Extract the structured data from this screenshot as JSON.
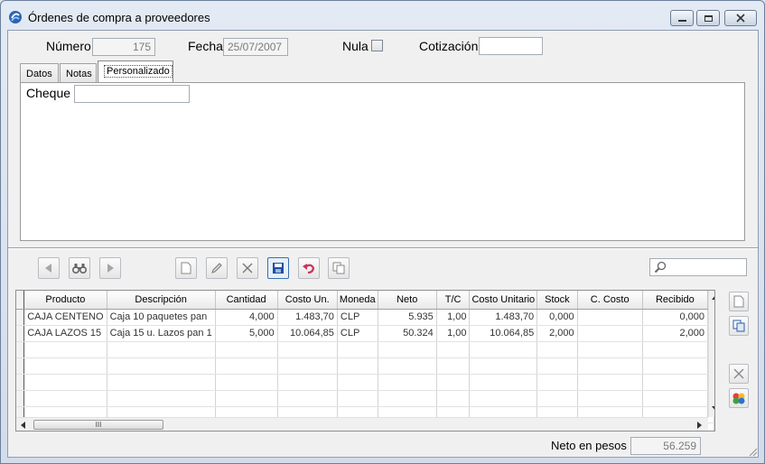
{
  "window": {
    "title": "Órdenes de compra a proveedores"
  },
  "header": {
    "numero_label": "Número",
    "numero_value": "175",
    "fecha_label": "Fecha",
    "fecha_value": "25/07/2007",
    "nula_label": "Nula",
    "nula_checked": false,
    "cotizacion_label": "Cotización",
    "cotizacion_value": ""
  },
  "tabs": [
    {
      "label": "Datos",
      "active": false
    },
    {
      "label": "Notas",
      "active": false
    },
    {
      "label": "Personalizado",
      "active": true
    }
  ],
  "panel": {
    "cheque_label": "Cheque",
    "cheque_value": ""
  },
  "toolbar": {
    "icons": [
      "arrow-left-icon",
      "binoculars-icon",
      "arrow-right-icon",
      "new-document-icon",
      "pencil-icon",
      "delete-x-icon",
      "save-disk-icon",
      "undo-icon",
      "copy-icon"
    ],
    "search_value": ""
  },
  "grid": {
    "columns": [
      "Producto",
      "Descripción",
      "Cantidad",
      "Costo Un.",
      "Moneda",
      "Neto",
      "T/C",
      "Costo Unitario",
      "Stock",
      "C. Costo",
      "Recibido"
    ],
    "rows": [
      [
        "CAJA CENTENO",
        "Caja 10 paquetes pan",
        "4,000",
        "1.483,70",
        "CLP",
        "5.935",
        "1,00",
        "1.483,70",
        "0,000",
        "",
        "0,000"
      ],
      [
        "CAJA LAZOS 15",
        "Caja 15 u. Lazos pan 1",
        "5,000",
        "10.064,85",
        "CLP",
        "50.324",
        "1,00",
        "10.064,85",
        "2,000",
        "",
        "2,000"
      ]
    ],
    "empty_rows": 6,
    "scroll_thumb_label": "III"
  },
  "footer": {
    "neto_label": "Neto en pesos",
    "neto_value": "56.259"
  },
  "colors": {
    "accent": "#3a6fb0",
    "window_frame": "#dbe3ee"
  }
}
